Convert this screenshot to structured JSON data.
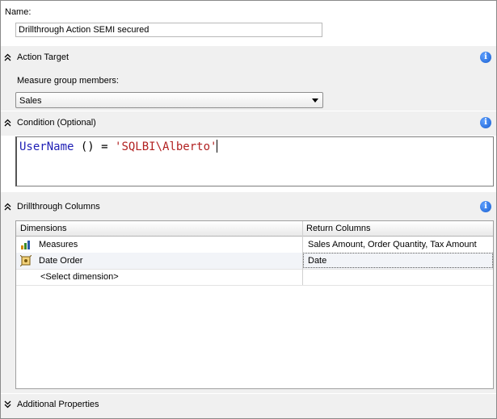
{
  "name": {
    "label": "Name:",
    "value": "Drillthrough Action SEMI secured"
  },
  "action_target": {
    "title": "Action Target",
    "icon": "info-icon",
    "measure_group_label": "Measure group members:",
    "measure_group_selected": "Sales"
  },
  "condition": {
    "title": "Condition (Optional)",
    "icon": "info-icon",
    "code": {
      "keyword": "UserName",
      "operator": " () = ",
      "string": "'SQLBI\\Alberto'"
    }
  },
  "drillthrough": {
    "title": "Drillthrough Columns",
    "icon": "info-icon",
    "columns": [
      "Dimensions",
      "Return Columns"
    ],
    "rows": [
      {
        "dimension": "Measures",
        "return_columns": "Sales Amount, Order Quantity, Tax Amount",
        "icon": "measures-icon"
      },
      {
        "dimension": "Date Order",
        "return_columns": "Date",
        "icon": "dimension-icon"
      },
      {
        "dimension": "<Select dimension>",
        "return_columns": "",
        "icon": ""
      }
    ]
  },
  "additional": {
    "title": "Additional Properties"
  },
  "colors": {
    "band": "#f0f0f0",
    "keyword": "#1f1fb5",
    "string": "#b22222",
    "info": "#1a5fd0"
  }
}
